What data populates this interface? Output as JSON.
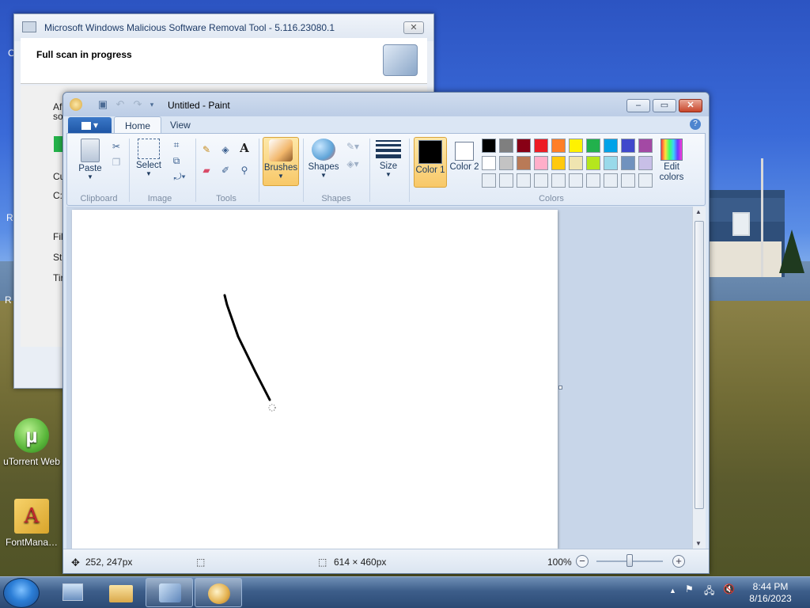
{
  "desktop": {
    "icons": [
      {
        "label": "uTorrent Web",
        "color": "#59b63a"
      },
      {
        "label": "FontMana…",
        "color": "#d9a52b"
      }
    ],
    "partial_labels": [
      "C",
      "R",
      "R"
    ]
  },
  "msrt": {
    "title": "Microsoft Windows Malicious Software Removal Tool - 5.116.23080.1",
    "heading": "Full scan in progress",
    "partial_lines": [
      "Af",
      "so",
      "Cu",
      "C:",
      "Fil",
      "St",
      "Tir"
    ],
    "close_label": "✕"
  },
  "paint": {
    "title": "Untitled - Paint",
    "window_buttons": {
      "minimize": "–",
      "maximize": "▭",
      "close": "✕"
    },
    "tabs": [
      {
        "label": "Home",
        "active": true
      },
      {
        "label": "View",
        "active": false
      }
    ],
    "app_menu_label": "▾",
    "help": "?",
    "ribbon": {
      "clipboard": {
        "paste": "Paste",
        "group": "Clipboard"
      },
      "image": {
        "select": "Select",
        "group": "Image"
      },
      "tools": {
        "group": "Tools",
        "text_tool": "A"
      },
      "brushes": {
        "label": "Brushes",
        "selected": true
      },
      "shapes": {
        "label": "Shapes",
        "group": "Shapes"
      },
      "size": {
        "label": "Size"
      },
      "color1": {
        "label": "Color 1",
        "value": "#000000",
        "selected": true
      },
      "color2": {
        "label": "Color 2",
        "value": "#ffffff"
      },
      "edit_colors": "Edit colors",
      "colors_group": "Colors",
      "palette": [
        "#000000",
        "#7f7f7f",
        "#880015",
        "#ed1c24",
        "#ff7f27",
        "#fff200",
        "#22b14c",
        "#00a2e8",
        "#3f48cc",
        "#a349a4",
        "#ffffff",
        "#c3c3c3",
        "#b97a57",
        "#ffaec9",
        "#ffc90e",
        "#efe4b0",
        "#b5e61d",
        "#99d9ea",
        "#7092be",
        "#c8bfe7",
        "#e8eef5",
        "#e8eef5",
        "#e8eef5",
        "#e8eef5",
        "#e8eef5",
        "#e8eef5",
        "#e8eef5",
        "#e8eef5",
        "#e8eef5",
        "#e8eef5"
      ]
    },
    "status": {
      "cursor_pos": "252, 247px",
      "image_size": "614 × 460px",
      "zoom": "100%",
      "zoom_out": "−",
      "zoom_in": "+"
    }
  },
  "taskbar": {
    "clock_time": "8:44 PM",
    "clock_date": "8/16/2023",
    "tray_arrow": "▲"
  }
}
